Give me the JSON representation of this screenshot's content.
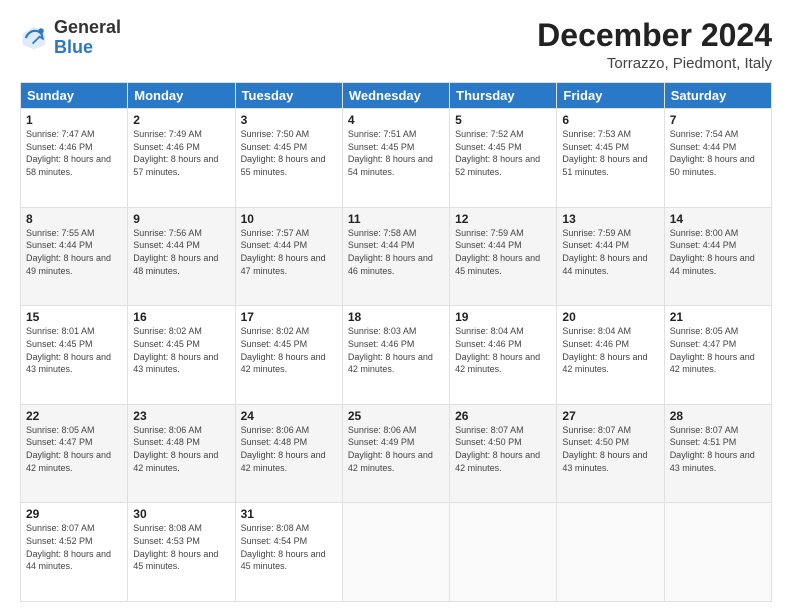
{
  "logo": {
    "general": "General",
    "blue": "Blue"
  },
  "header": {
    "month": "December 2024",
    "location": "Torrazzo, Piedmont, Italy"
  },
  "weekdays": [
    "Sunday",
    "Monday",
    "Tuesday",
    "Wednesday",
    "Thursday",
    "Friday",
    "Saturday"
  ],
  "weeks": [
    [
      {
        "day": "1",
        "sunrise": "Sunrise: 7:47 AM",
        "sunset": "Sunset: 4:46 PM",
        "daylight": "Daylight: 8 hours and 58 minutes."
      },
      {
        "day": "2",
        "sunrise": "Sunrise: 7:49 AM",
        "sunset": "Sunset: 4:46 PM",
        "daylight": "Daylight: 8 hours and 57 minutes."
      },
      {
        "day": "3",
        "sunrise": "Sunrise: 7:50 AM",
        "sunset": "Sunset: 4:45 PM",
        "daylight": "Daylight: 8 hours and 55 minutes."
      },
      {
        "day": "4",
        "sunrise": "Sunrise: 7:51 AM",
        "sunset": "Sunset: 4:45 PM",
        "daylight": "Daylight: 8 hours and 54 minutes."
      },
      {
        "day": "5",
        "sunrise": "Sunrise: 7:52 AM",
        "sunset": "Sunset: 4:45 PM",
        "daylight": "Daylight: 8 hours and 52 minutes."
      },
      {
        "day": "6",
        "sunrise": "Sunrise: 7:53 AM",
        "sunset": "Sunset: 4:45 PM",
        "daylight": "Daylight: 8 hours and 51 minutes."
      },
      {
        "day": "7",
        "sunrise": "Sunrise: 7:54 AM",
        "sunset": "Sunset: 4:44 PM",
        "daylight": "Daylight: 8 hours and 50 minutes."
      }
    ],
    [
      {
        "day": "8",
        "sunrise": "Sunrise: 7:55 AM",
        "sunset": "Sunset: 4:44 PM",
        "daylight": "Daylight: 8 hours and 49 minutes."
      },
      {
        "day": "9",
        "sunrise": "Sunrise: 7:56 AM",
        "sunset": "Sunset: 4:44 PM",
        "daylight": "Daylight: 8 hours and 48 minutes."
      },
      {
        "day": "10",
        "sunrise": "Sunrise: 7:57 AM",
        "sunset": "Sunset: 4:44 PM",
        "daylight": "Daylight: 8 hours and 47 minutes."
      },
      {
        "day": "11",
        "sunrise": "Sunrise: 7:58 AM",
        "sunset": "Sunset: 4:44 PM",
        "daylight": "Daylight: 8 hours and 46 minutes."
      },
      {
        "day": "12",
        "sunrise": "Sunrise: 7:59 AM",
        "sunset": "Sunset: 4:44 PM",
        "daylight": "Daylight: 8 hours and 45 minutes."
      },
      {
        "day": "13",
        "sunrise": "Sunrise: 7:59 AM",
        "sunset": "Sunset: 4:44 PM",
        "daylight": "Daylight: 8 hours and 44 minutes."
      },
      {
        "day": "14",
        "sunrise": "Sunrise: 8:00 AM",
        "sunset": "Sunset: 4:44 PM",
        "daylight": "Daylight: 8 hours and 44 minutes."
      }
    ],
    [
      {
        "day": "15",
        "sunrise": "Sunrise: 8:01 AM",
        "sunset": "Sunset: 4:45 PM",
        "daylight": "Daylight: 8 hours and 43 minutes."
      },
      {
        "day": "16",
        "sunrise": "Sunrise: 8:02 AM",
        "sunset": "Sunset: 4:45 PM",
        "daylight": "Daylight: 8 hours and 43 minutes."
      },
      {
        "day": "17",
        "sunrise": "Sunrise: 8:02 AM",
        "sunset": "Sunset: 4:45 PM",
        "daylight": "Daylight: 8 hours and 42 minutes."
      },
      {
        "day": "18",
        "sunrise": "Sunrise: 8:03 AM",
        "sunset": "Sunset: 4:46 PM",
        "daylight": "Daylight: 8 hours and 42 minutes."
      },
      {
        "day": "19",
        "sunrise": "Sunrise: 8:04 AM",
        "sunset": "Sunset: 4:46 PM",
        "daylight": "Daylight: 8 hours and 42 minutes."
      },
      {
        "day": "20",
        "sunrise": "Sunrise: 8:04 AM",
        "sunset": "Sunset: 4:46 PM",
        "daylight": "Daylight: 8 hours and 42 minutes."
      },
      {
        "day": "21",
        "sunrise": "Sunrise: 8:05 AM",
        "sunset": "Sunset: 4:47 PM",
        "daylight": "Daylight: 8 hours and 42 minutes."
      }
    ],
    [
      {
        "day": "22",
        "sunrise": "Sunrise: 8:05 AM",
        "sunset": "Sunset: 4:47 PM",
        "daylight": "Daylight: 8 hours and 42 minutes."
      },
      {
        "day": "23",
        "sunrise": "Sunrise: 8:06 AM",
        "sunset": "Sunset: 4:48 PM",
        "daylight": "Daylight: 8 hours and 42 minutes."
      },
      {
        "day": "24",
        "sunrise": "Sunrise: 8:06 AM",
        "sunset": "Sunset: 4:48 PM",
        "daylight": "Daylight: 8 hours and 42 minutes."
      },
      {
        "day": "25",
        "sunrise": "Sunrise: 8:06 AM",
        "sunset": "Sunset: 4:49 PM",
        "daylight": "Daylight: 8 hours and 42 minutes."
      },
      {
        "day": "26",
        "sunrise": "Sunrise: 8:07 AM",
        "sunset": "Sunset: 4:50 PM",
        "daylight": "Daylight: 8 hours and 42 minutes."
      },
      {
        "day": "27",
        "sunrise": "Sunrise: 8:07 AM",
        "sunset": "Sunset: 4:50 PM",
        "daylight": "Daylight: 8 hours and 43 minutes."
      },
      {
        "day": "28",
        "sunrise": "Sunrise: 8:07 AM",
        "sunset": "Sunset: 4:51 PM",
        "daylight": "Daylight: 8 hours and 43 minutes."
      }
    ],
    [
      {
        "day": "29",
        "sunrise": "Sunrise: 8:07 AM",
        "sunset": "Sunset: 4:52 PM",
        "daylight": "Daylight: 8 hours and 44 minutes."
      },
      {
        "day": "30",
        "sunrise": "Sunrise: 8:08 AM",
        "sunset": "Sunset: 4:53 PM",
        "daylight": "Daylight: 8 hours and 45 minutes."
      },
      {
        "day": "31",
        "sunrise": "Sunrise: 8:08 AM",
        "sunset": "Sunset: 4:54 PM",
        "daylight": "Daylight: 8 hours and 45 minutes."
      },
      null,
      null,
      null,
      null
    ]
  ]
}
